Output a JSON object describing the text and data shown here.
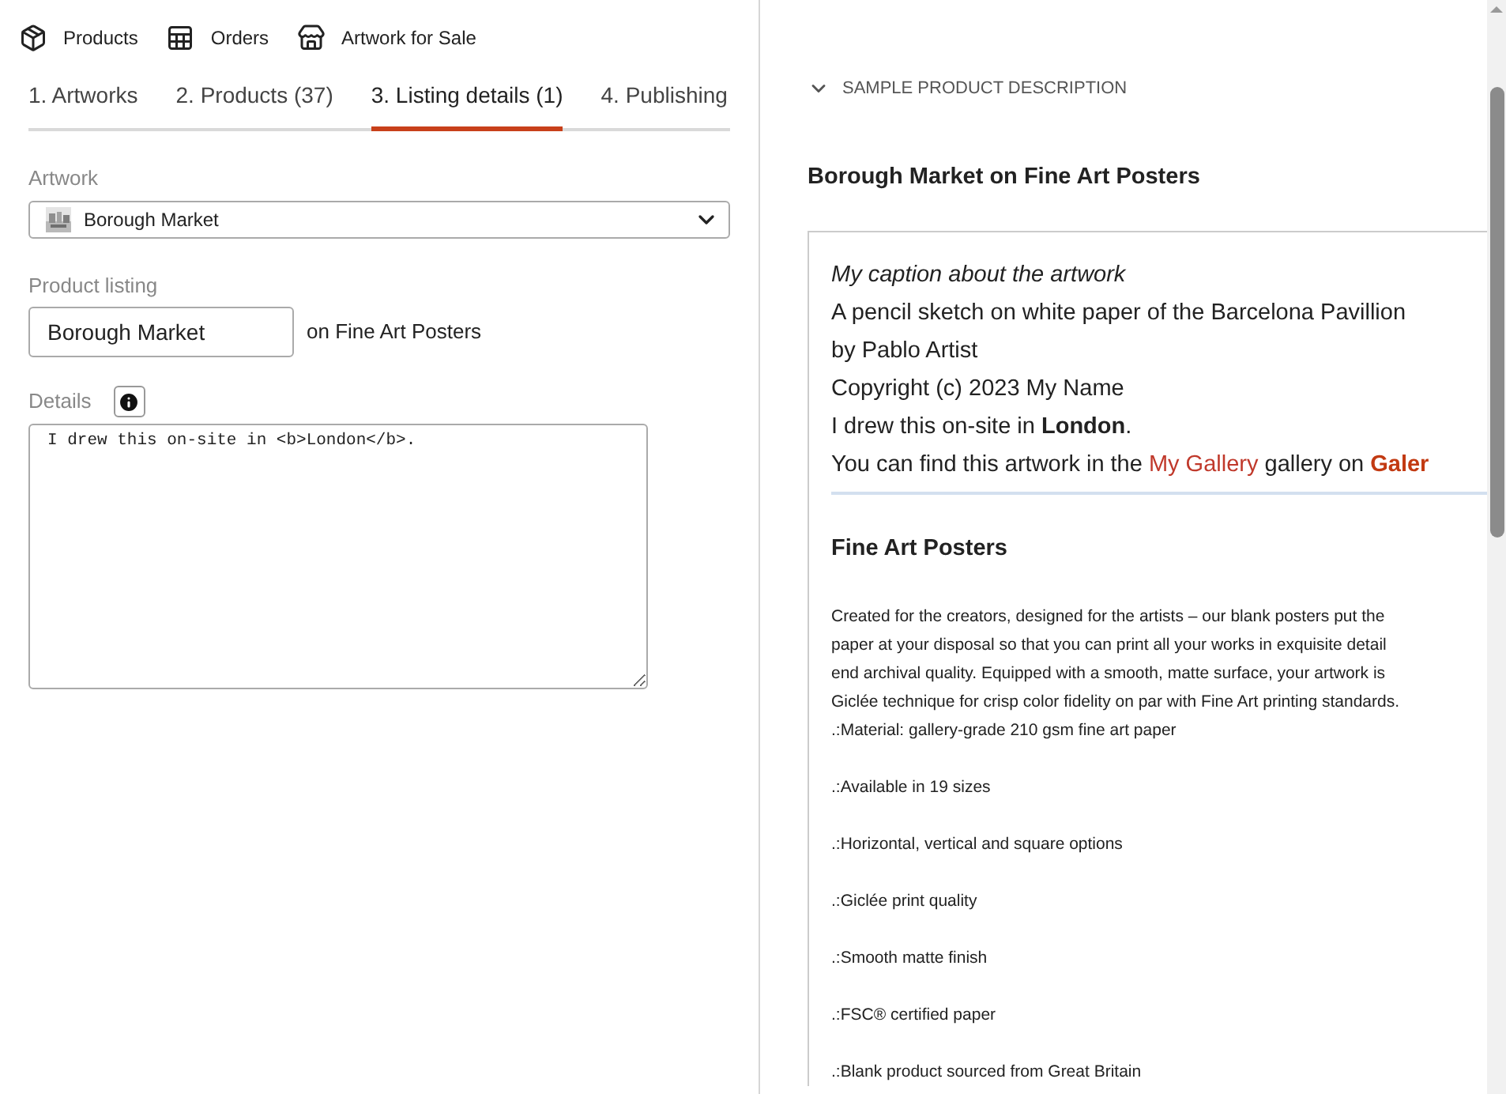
{
  "nav": [
    {
      "label": "Products"
    },
    {
      "label": "Orders"
    },
    {
      "label": "Artwork for Sale"
    }
  ],
  "tabs": [
    {
      "label": "1. Artworks",
      "selected": false
    },
    {
      "label": "2. Products (37)",
      "selected": false
    },
    {
      "label": "3. Listing details (1)",
      "selected": true
    },
    {
      "label": "4. Publishing",
      "selected": false
    }
  ],
  "form": {
    "artwork": {
      "label": "Artwork",
      "value": "Borough Market"
    },
    "product_listing": {
      "label": "Product listing",
      "value": "Borough Market",
      "suffix": "on Fine Art Posters"
    },
    "details": {
      "label": "Details",
      "value": "I drew this on-site in <b>London</b>."
    }
  },
  "preview": {
    "section_title": "SAMPLE PRODUCT DESCRIPTION",
    "expanded": true,
    "heading": "Borough Market on Fine Art Posters",
    "lines": [
      {
        "kind": "italic",
        "text": "My caption about the artwork"
      },
      {
        "kind": "plain",
        "text": "A pencil sketch on white paper of the Barcelona Pavillion"
      },
      {
        "kind": "plain",
        "text": "by Pablo Artist"
      },
      {
        "kind": "plain",
        "text": "Copyright (c) 2023 My Name"
      },
      {
        "kind": "plain",
        "text": "I drew this on-site in **London**."
      },
      {
        "kind": "links",
        "segments": [
          {
            "kind": "text",
            "text": "You can find this artwork in the"
          },
          {
            "kind": "link",
            "text": "My Gallery"
          },
          {
            "kind": "text",
            "text": "gallery on"
          },
          {
            "kind": "strong_link",
            "text": "Galer"
          }
        ]
      }
    ],
    "product_title": "Fine Art Posters",
    "paragraph_lines": [
      "Created for the creators, designed for the artists – our blank posters put the",
      "paper at your disposal so that you can print all your works in exquisite detail",
      "end archival quality. Equipped with a smooth, matte surface, your artwork is",
      "Giclée technique for crisp color fidelity on par with Fine Art printing standards.",
      ".:Material: gallery-grade 210 gsm fine art paper"
    ],
    "features": [
      ".:Available in 19 sizes",
      ".:Horizontal, vertical and square options",
      ".:Giclée print quality",
      ".:Smooth matte finish",
      ".:FSC® certified paper",
      ".:Blank product sourced from Great Britain"
    ]
  }
}
